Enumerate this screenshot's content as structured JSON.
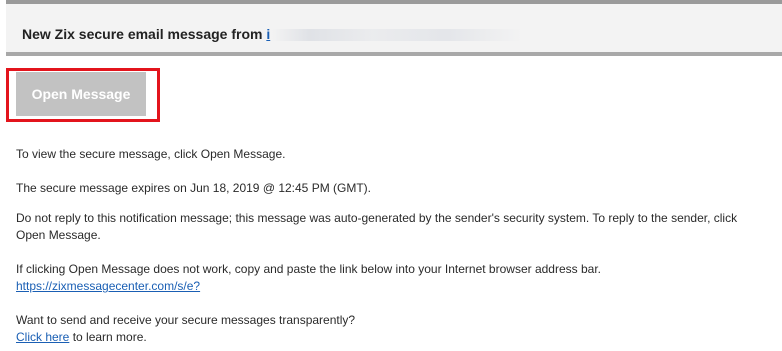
{
  "header": {
    "title": "New Zix secure email message from",
    "sender_visible": "i"
  },
  "button": {
    "label": "Open Message"
  },
  "body": {
    "line1": "To view the secure message, click Open Message.",
    "line2": "The secure message expires on Jun 18, 2019 @ 12:45 PM (GMT).",
    "line3": "Do not reply to this notification message; this message was auto-generated by the sender's security system. To reply to the sender, click Open Message.",
    "line4_text": "If clicking Open Message does not work, copy and paste the link below into your Internet browser address bar.",
    "line4_link": "https://zixmessagecenter.com/s/e?",
    "line5_text": "Want to send and receive your secure messages transparently?",
    "line5_link": "Click here",
    "line5_suffix": " to learn more."
  },
  "colors": {
    "highlight": "#e3141c",
    "button_bg": "#c2c2c2",
    "link": "#1a5fb4"
  }
}
